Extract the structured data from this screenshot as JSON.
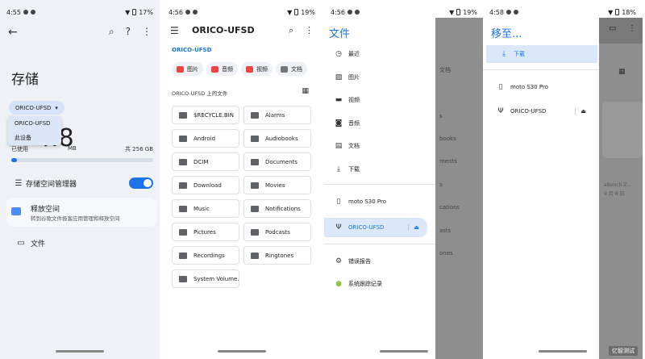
{
  "panel1": {
    "status": {
      "time": "4:55",
      "battery": "17%"
    },
    "title": "存储",
    "device_chip": "ORICO-UFSD",
    "dropdown": [
      "ORICO-UFSD",
      "此设备"
    ],
    "used_value": "4.8",
    "used_unit": "MB",
    "used_label": "已使用",
    "total": "共 256 GB",
    "usage_fraction": 0.04,
    "manager_label": "存储空间管理器",
    "free_title": "释放空间",
    "free_sub": "转到谷歌文件极客应用管理和释放空间",
    "files_label": "文件"
  },
  "panel2": {
    "status": {
      "time": "4:56",
      "battery": "19%"
    },
    "app_title": "ORICO-UFSD",
    "breadcrumb": "ORICO-UFSD",
    "chips": [
      "图片",
      "音频",
      "视频",
      "文档"
    ],
    "section": "ORICO-UFSD 上的文件",
    "folders": [
      "$RECYCLE.BIN",
      "Alarms",
      "Android",
      "Audiobooks",
      "DCIM",
      "Documents",
      "Download",
      "Movies",
      "Music",
      "Notifications",
      "Pictures",
      "Podcasts",
      "Recordings",
      "Ringtones",
      "System Volume..."
    ]
  },
  "panel3": {
    "status": {
      "time": "4:56",
      "battery": "19%"
    },
    "drawer_title": "文件",
    "items": [
      "最近",
      "图片",
      "视频",
      "音频",
      "文档",
      "下载"
    ],
    "devices": [
      "moto S30 Pro",
      "ORICO-UFSD"
    ],
    "extra": [
      "错误报告",
      "系统跟踪记录"
    ],
    "behind": [
      "文档",
      "s",
      "books",
      "ments",
      "s",
      "cations",
      "asts",
      "ones"
    ]
  },
  "panel4": {
    "status": {
      "time": "4:58",
      "battery": "18%"
    },
    "drawer_title": "移至...",
    "download": "下载",
    "devices": [
      "moto S30 Pro",
      "ORICO-UFSD"
    ],
    "behind": [
      "aBench Z...",
      "9 月 8 日"
    ]
  },
  "watermark": "亿智测试"
}
